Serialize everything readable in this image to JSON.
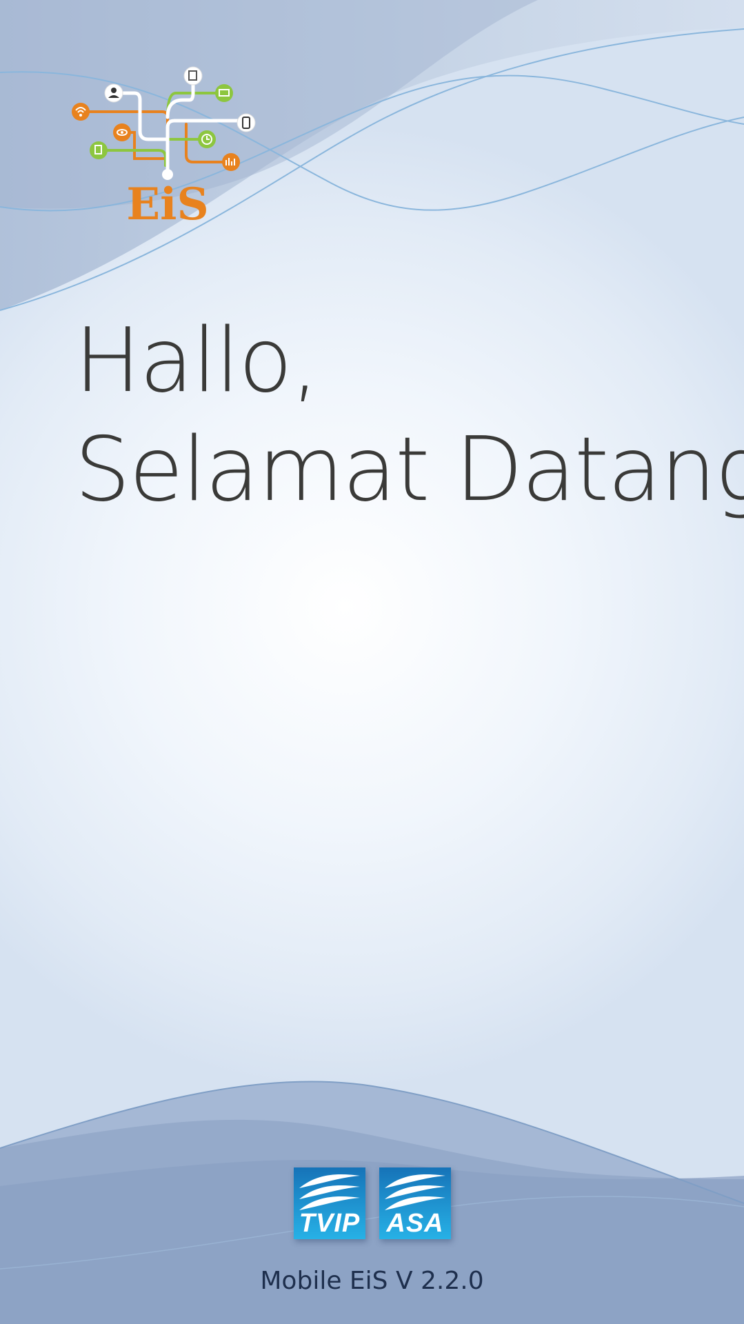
{
  "app": {
    "logo_text": "EiS",
    "greeting_line1": "Hallo,",
    "greeting_line2": "Selamat Datang",
    "partner_logos": [
      {
        "name": "TVIP",
        "label": "TVIP"
      },
      {
        "name": "ASA",
        "label": "ASA"
      }
    ],
    "version_text": "Mobile EiS V 2.2.0"
  },
  "colors": {
    "brand_orange": "#E8821E",
    "brand_green": "#8DC63F",
    "partner_blue": "#1C9BD8",
    "text_dark": "#3A3A38",
    "version_text": "#1E2F4D"
  }
}
